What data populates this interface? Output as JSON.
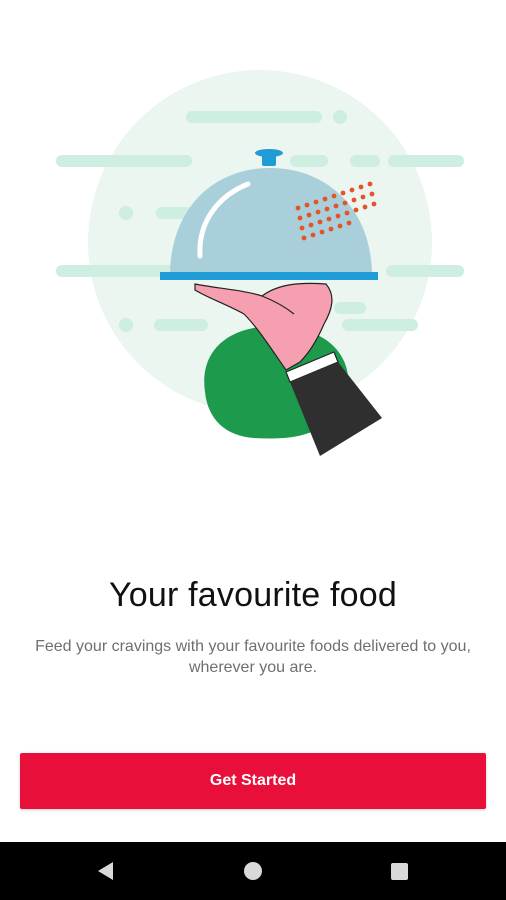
{
  "onboarding": {
    "title": "Your favourite food",
    "subtitle": "Feed your cravings with your favourite foods delivered to you, wherever you are.",
    "cta_label": "Get Started"
  },
  "illustration": {
    "icon": "serving-cloche-illustration",
    "colors": {
      "circle": "#eaf6ef",
      "stripes": "#cdeee0",
      "cloche": "#a9cfda",
      "tray": "#1f9bd6",
      "dots": "#e5532a",
      "hand": "#f59fb0",
      "sleeve": "#2f2f2f",
      "green": "#1e9a4c"
    }
  },
  "theme": {
    "accent": "#e8103a",
    "navbar": "#000000"
  },
  "navbar": {
    "back_icon": "back-icon",
    "home_icon": "home-icon",
    "recent_icon": "recent-apps-icon"
  }
}
